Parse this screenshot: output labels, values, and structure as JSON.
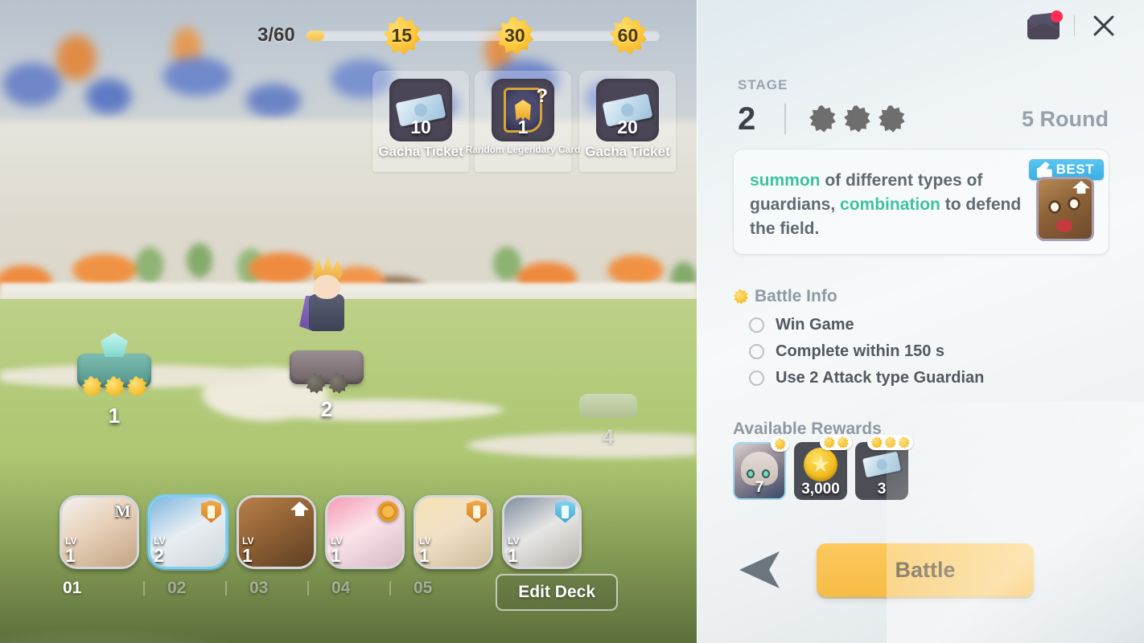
{
  "scene": {
    "progress": {
      "label": "3/60",
      "current": 3,
      "total": 60,
      "fill_percent": 5,
      "milestones": [
        {
          "value": "15",
          "position_percent": 27
        },
        {
          "value": "30",
          "position_percent": 59
        },
        {
          "value": "60",
          "position_percent": 91
        }
      ]
    },
    "milestone_rewards": [
      {
        "name": "Gacha Ticket",
        "qty": "10",
        "icon": "ticket-icon"
      },
      {
        "name": "Random Legendary Card",
        "qty": "1",
        "icon": "legendary-card-icon"
      },
      {
        "name": "Gacha Ticket",
        "qty": "20",
        "icon": "ticket-icon"
      }
    ],
    "map_nodes": [
      {
        "number": "1",
        "stars": 3,
        "state": "cleared"
      },
      {
        "number": "2",
        "stars": 2,
        "state": "current"
      },
      {
        "number": "4",
        "stars": 0,
        "state": "locked"
      }
    ],
    "deck": {
      "cards": [
        {
          "level_label": "LV",
          "level": "1",
          "badge": "m-rank-icon",
          "selected": false
        },
        {
          "level_label": "LV",
          "level": "2",
          "badge": "shield-orange-icon",
          "selected": true
        },
        {
          "level_label": "LV",
          "level": "1",
          "badge": "upgrade-arrow-icon",
          "selected": false
        },
        {
          "level_label": "LV",
          "level": "1",
          "badge": "gear-icon",
          "selected": false
        },
        {
          "level_label": "LV",
          "level": "1",
          "badge": "shield-orange-icon",
          "selected": false
        },
        {
          "level_label": "LV",
          "level": "1",
          "badge": "shield-teal-icon",
          "selected": false
        }
      ],
      "slots": [
        "01",
        "02",
        "03",
        "04",
        "05"
      ],
      "active_slot": "01",
      "edit_label": "Edit Deck"
    }
  },
  "panel": {
    "mail_icon": "mail-icon",
    "mail_has_notification": true,
    "close_icon": "close-icon",
    "stage_label": "STAGE",
    "stage_number": "2",
    "stage_stars_total": 3,
    "stage_stars_earned": 0,
    "round_text": "5 Round",
    "tip": {
      "segments": [
        {
          "text": "summon",
          "highlight": true
        },
        {
          "text": " of different types of guardians, ",
          "highlight": false
        },
        {
          "text": "combination",
          "highlight": true
        },
        {
          "text": " to defend the field.",
          "highlight": false
        }
      ],
      "badge_label": "BEST",
      "thumb_icon": "guardian-portrait-icon"
    },
    "battle_info": {
      "title": "Battle Info",
      "objectives": [
        {
          "text": "Win Game",
          "completed": false
        },
        {
          "text": "Complete within 150 s",
          "completed": false
        },
        {
          "text": "Use 2 Attack type Guardian",
          "completed": false
        }
      ]
    },
    "rewards": {
      "title": "Available Rewards",
      "items": [
        {
          "qty": "7",
          "stars": 1,
          "icon": "character-shard-icon"
        },
        {
          "qty": "3,000",
          "stars": 2,
          "icon": "gold-coin-icon"
        },
        {
          "qty": "3",
          "stars": 3,
          "icon": "ticket-icon"
        }
      ]
    },
    "back_icon": "back-arrow-icon",
    "battle_button": "Battle"
  },
  "colors": {
    "accent_battle": "#f6bc46",
    "tip_highlight": "#3ec2a2",
    "best_badge": "#3aaee4",
    "notification_dot": "#ff2d55"
  }
}
